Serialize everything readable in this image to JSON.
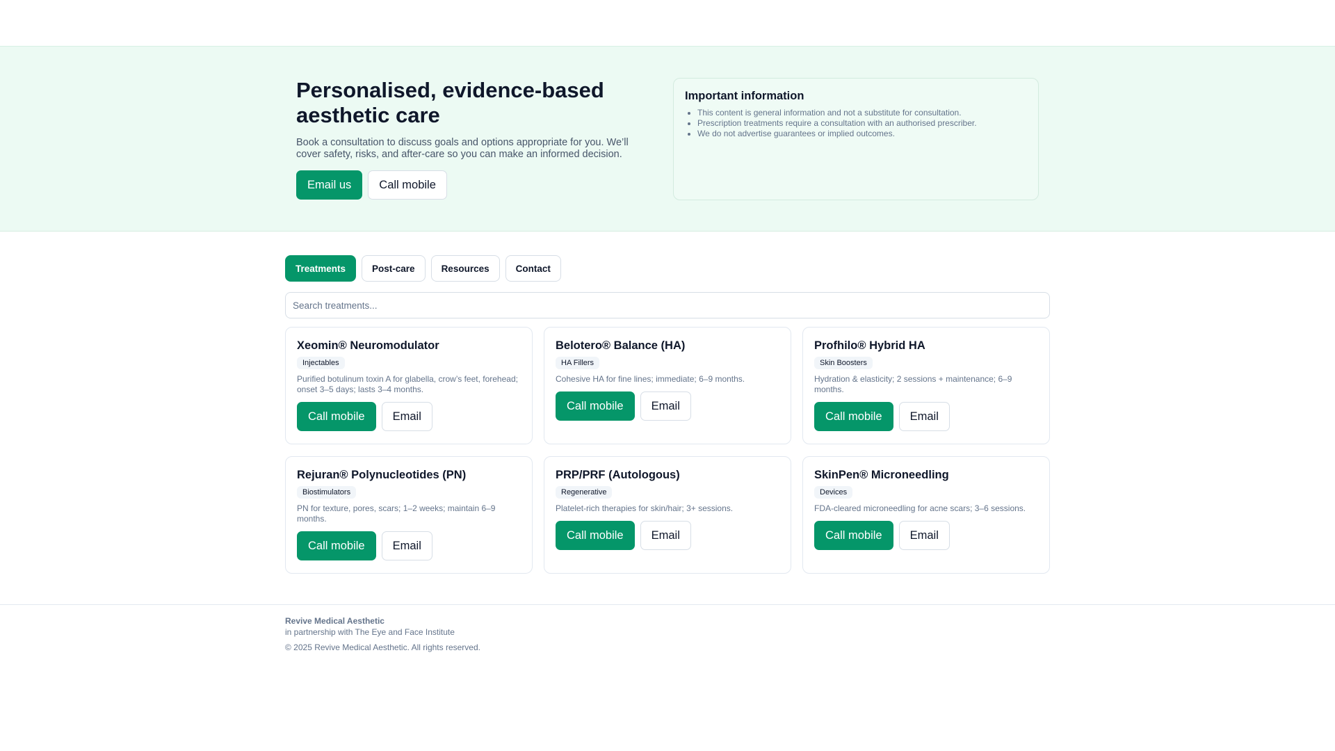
{
  "hero": {
    "title": "Personalised, evidence-based aesthetic care",
    "subtitle": "Book a consultation to discuss goals and options appropriate for you. We’ll cover safety, risks, and after-care so you can make an informed decision.",
    "email_label": "Email us",
    "call_label": "Call mobile"
  },
  "info": {
    "title": "Important information",
    "items": [
      "This content is general information and not a substitute for consultation.",
      "Prescription treatments require a consultation with an authorised prescriber.",
      "We do not advertise guarantees or implied outcomes."
    ]
  },
  "tabs": [
    {
      "label": "Treatments",
      "active": true
    },
    {
      "label": "Post-care",
      "active": false
    },
    {
      "label": "Resources",
      "active": false
    },
    {
      "label": "Contact",
      "active": false
    }
  ],
  "search": {
    "placeholder": "Search treatments..."
  },
  "cards": [
    {
      "title": "Xeomin® Neuromodulator",
      "tag": "Injectables",
      "desc": "Purified botulinum toxin A for glabella, crow’s feet, forehead; onset 3–5 days; lasts 3–4 months.",
      "call": "Call mobile",
      "email": "Email"
    },
    {
      "title": "Belotero® Balance (HA)",
      "tag": "HA Fillers",
      "desc": "Cohesive HA for fine lines; immediate; 6–9 months.",
      "call": "Call mobile",
      "email": "Email"
    },
    {
      "title": "Profhilo® Hybrid HA",
      "tag": "Skin Boosters",
      "desc": "Hydration & elasticity; 2 sessions + maintenance; 6–9 months.",
      "call": "Call mobile",
      "email": "Email"
    },
    {
      "title": "Rejuran® Polynucleotides (PN)",
      "tag": "Biostimulators",
      "desc": "PN for texture, pores, scars; 1–2 weeks; maintain 6–9 months.",
      "call": "Call mobile",
      "email": "Email"
    },
    {
      "title": "PRP/PRF (Autologous)",
      "tag": "Regenerative",
      "desc": "Platelet-rich therapies for skin/hair; 3+ sessions.",
      "call": "Call mobile",
      "email": "Email"
    },
    {
      "title": "SkinPen® Microneedling",
      "tag": "Devices",
      "desc": "FDA-cleared microneedling for acne scars; 3–6 sessions.",
      "call": "Call mobile",
      "email": "Email"
    }
  ],
  "footer": {
    "brand": "Revive Medical Aesthetic",
    "partner": "in partnership with The Eye and Face Institute",
    "copyright": "© 2025 Revive Medical Aesthetic. All rights reserved."
  },
  "colors": {
    "accent": "#059669",
    "hero_bg": "#ecfaf3",
    "muted_text": "#64748b"
  }
}
